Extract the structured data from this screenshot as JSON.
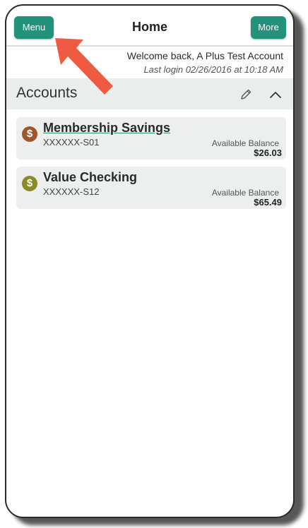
{
  "header": {
    "menu_label": "Menu",
    "title": "Home",
    "more_label": "More"
  },
  "welcome": {
    "line1": "Welcome back, A Plus Test Account",
    "line2": "Last login 02/26/2016 at 10:18 AM"
  },
  "accounts": {
    "title": "Accounts",
    "items": [
      {
        "icon": "$",
        "name": "Membership Savings",
        "number": "XXXXXX-S01",
        "balance_label": "Available Balance",
        "balance": "$26.03"
      },
      {
        "icon": "$",
        "name": "Value Checking",
        "number": "XXXXXX-S12",
        "balance_label": "Available Balance",
        "balance": "$65.49"
      }
    ]
  },
  "colors": {
    "accent": "#22927a",
    "annotation_arrow": "#ef5a43",
    "coin_savings": "#a0552a",
    "coin_checking": "#8c8a28"
  },
  "icons": [
    "pencil-icon",
    "chevron-up-icon",
    "dollar-coin-icon",
    "pointer-arrow-icon"
  ]
}
